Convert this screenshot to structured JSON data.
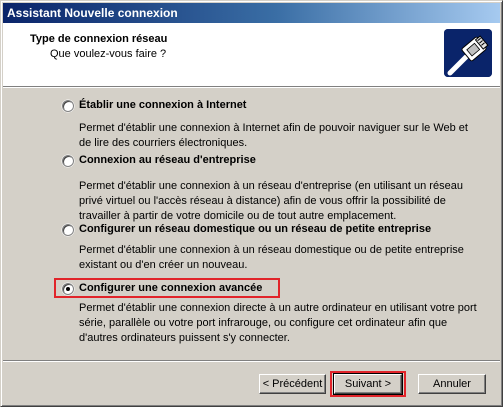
{
  "window": {
    "title": "Assistant Nouvelle connexion"
  },
  "header": {
    "title": "Type de connexion réseau",
    "subtitle": "Que voulez-vous faire ?",
    "icon": "network-cable-icon"
  },
  "options": [
    {
      "label": "Établir une connexion à Internet",
      "description": "Permet d'établir une connexion à Internet afin de pouvoir naviguer sur le Web et de lire des courriers électroniques.",
      "selected": false
    },
    {
      "label": "Connexion au réseau d'entreprise",
      "description": "Permet d'établir une connexion à un réseau d'entreprise (en utilisant un réseau privé virtuel ou l'accès réseau à distance) afin de vous offrir la possibilité de travailler à partir de votre domicile ou de tout autre emplacement.",
      "selected": false
    },
    {
      "label": "Configurer un réseau domestique ou un réseau de petite entreprise",
      "description": "Permet d'établir une connexion à un réseau domestique ou de petite entreprise existant ou d'en créer un nouveau.",
      "selected": false
    },
    {
      "label": "Configurer une connexion avancée",
      "description": "Permet d'établir une connexion directe à un autre ordinateur en utilisant votre port série, parallèle ou votre port infrarouge, ou configure cet ordinateur afin que d'autres ordinateurs puissent s'y connecter.",
      "selected": true
    }
  ],
  "buttons": {
    "back": "< Précédent",
    "next": "Suivant >",
    "cancel": "Annuler"
  },
  "colors": {
    "titlebar": "#0a246a",
    "highlight": "#e1242a",
    "background": "#d4d0c8"
  }
}
